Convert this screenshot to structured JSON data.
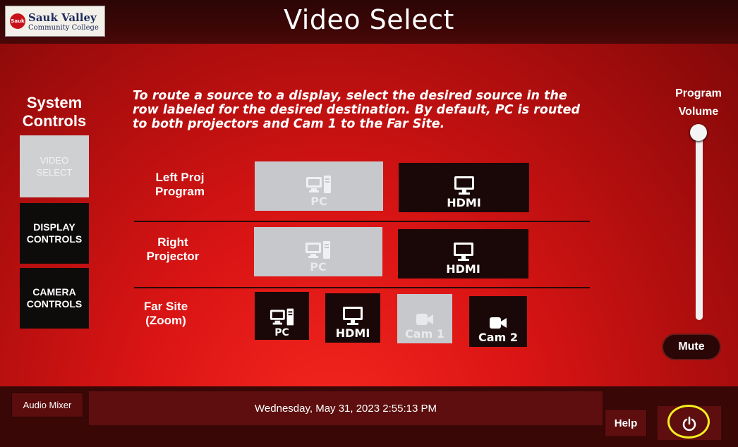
{
  "header": {
    "logo": {
      "badge": "Sauk",
      "name": "Sauk Valley",
      "sub": "Community College"
    },
    "title": "Video Select"
  },
  "nav": {
    "title_line1": "System",
    "title_line2": "Controls",
    "buttons": [
      {
        "line1": "VIDEO",
        "line2": "SELECT",
        "active": true
      },
      {
        "line1": "DISPLAY",
        "line2": "CONTROLS",
        "active": false
      },
      {
        "line1": "CAMERA",
        "line2": "CONTROLS",
        "active": false
      }
    ]
  },
  "instructions": {
    "line1": "To route a source to a display, select the desired source in the",
    "line2": "row labeled for the desired destination. By default, PC is routed",
    "line3": "to both projectors and Cam 1 to the Far Site."
  },
  "rows": [
    {
      "label_line1": "Left Proj",
      "label_line2": "Program",
      "sources": [
        {
          "label": "PC",
          "icon": "pc-icon",
          "selected": true
        },
        {
          "label": "HDMI",
          "icon": "monitor-icon",
          "selected": false
        }
      ]
    },
    {
      "label_line1": "Right",
      "label_line2": "Projector",
      "sources": [
        {
          "label": "PC",
          "icon": "pc-icon",
          "selected": true
        },
        {
          "label": "HDMI",
          "icon": "monitor-icon",
          "selected": false
        }
      ]
    },
    {
      "label_line1": "Far Site",
      "label_line2": "(Zoom)",
      "sources": [
        {
          "label": "PC",
          "icon": "pc-icon",
          "selected": false
        },
        {
          "label": "HDMI",
          "icon": "monitor-icon",
          "selected": false
        },
        {
          "label": "Cam 1",
          "icon": "camera-icon",
          "selected": true
        },
        {
          "label": "Cam 2",
          "icon": "camera-icon",
          "selected": false
        }
      ]
    }
  ],
  "volume": {
    "label_line1": "Program",
    "label_line2": "Volume",
    "level": 1.0,
    "mute_label": "Mute"
  },
  "footer": {
    "audio_mixer": "Audio Mixer",
    "datetime": "Wednesday, May 31, 2023 2:55:13 PM",
    "help": "Help",
    "power_icon": "power-icon"
  },
  "colors": {
    "background": "#d91414",
    "header": "#3b0606",
    "selected_button": "#c6c8cc",
    "unselected_button": "#1a0808",
    "highlight_ring": "#f4ef1f"
  }
}
